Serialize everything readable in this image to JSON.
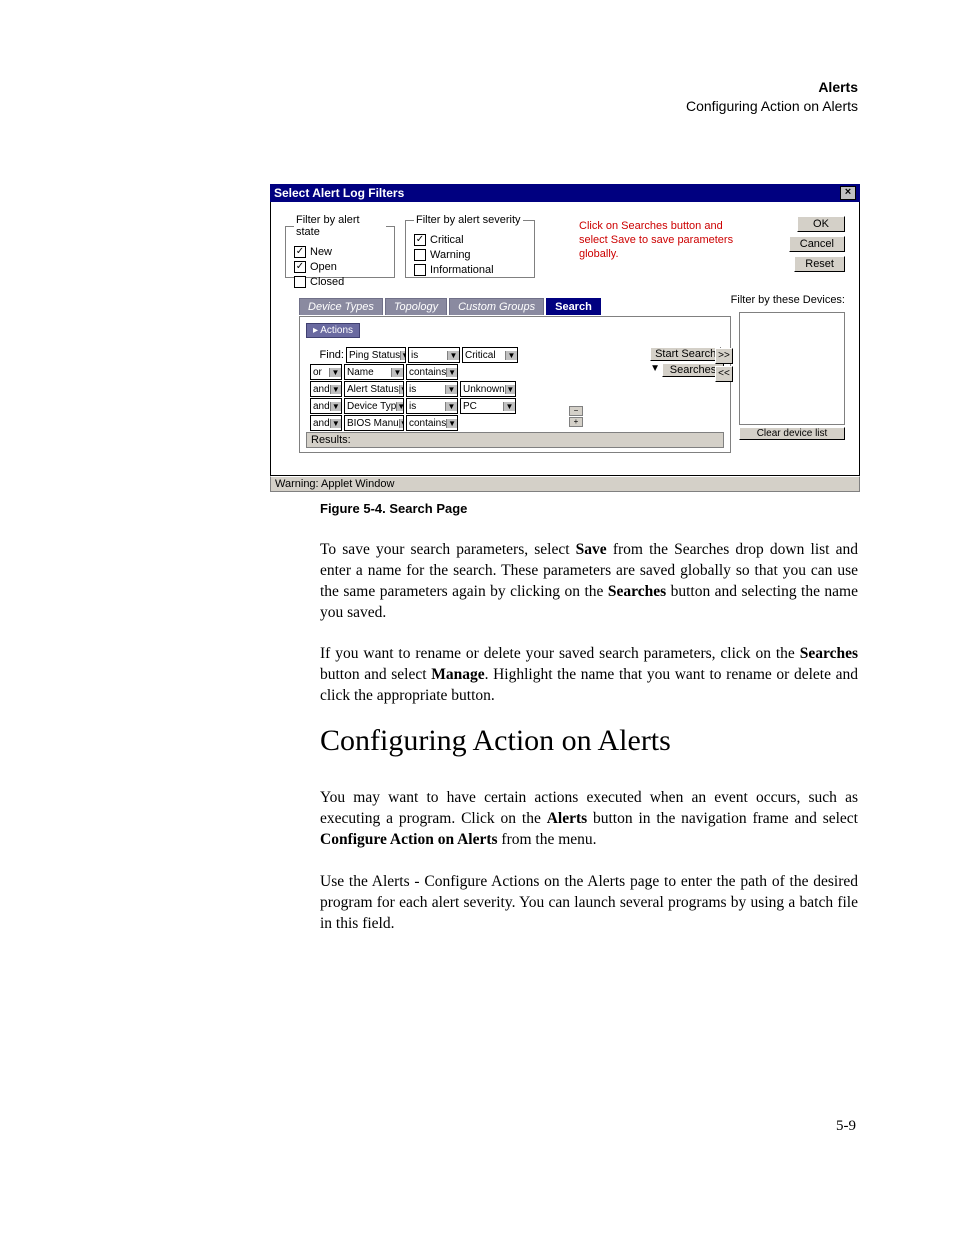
{
  "header": {
    "title": "Alerts",
    "subtitle": "Configuring Action on Alerts"
  },
  "dialog": {
    "title": "Select Alert Log Filters",
    "close_glyph": "×",
    "hint": "Click on Searches button and select Save to save parameters globally.",
    "buttons": {
      "ok": "OK",
      "cancel": "Cancel",
      "reset": "Reset"
    },
    "filter_by_devices_label": "Filter by these Devices:",
    "state_group": {
      "legend": "Filter by alert state",
      "items": [
        {
          "label": "New",
          "checked": true
        },
        {
          "label": "Open",
          "checked": true
        },
        {
          "label": "Closed",
          "checked": false
        }
      ]
    },
    "sev_group": {
      "legend": "Filter by alert severity",
      "items": [
        {
          "label": "Critical",
          "checked": true
        },
        {
          "label": "Warning",
          "checked": false
        },
        {
          "label": "Informational",
          "checked": false
        }
      ]
    },
    "tabs": {
      "t0": "Device Types",
      "t1": "Topology",
      "t2": "Custom Groups",
      "t3": "Search"
    },
    "actions_pill": "▸ Actions",
    "find_label": "Find:",
    "rows": [
      {
        "conn": "",
        "field": "Ping Status",
        "op": "is",
        "val": "Critical"
      },
      {
        "conn": "or",
        "field": "Name",
        "op": "contains",
        "val": ""
      },
      {
        "conn": "and",
        "field": "Alert Status",
        "op": "is",
        "val": "Unknown"
      },
      {
        "conn": "and",
        "field": "Device Typ",
        "op": "is",
        "val": "PC"
      },
      {
        "conn": "and",
        "field": "BIOS Manu",
        "op": "contains",
        "val": ""
      }
    ],
    "start_search": "Start Search",
    "searches_btn": "Searches",
    "tri_down": "▼",
    "move_right": ">>",
    "move_left": "<<",
    "stack_minus": "−",
    "stack_plus": "+",
    "results_label": "Results:",
    "clear_devices": "Clear device list",
    "applet_warn": "Warning: Applet Window"
  },
  "figure_caption": "Figure 5-4.    Search Page",
  "p1_a": "To save your search parameters, select ",
  "p1_b": "Save",
  "p1_c": " from the Searches drop down list and enter a name for the search. These parameters are saved globally so that you can use the same parameters again by clicking on the ",
  "p1_d": "Searches",
  "p1_e": " button and selecting the name you saved.",
  "p2_a": "If you want to rename or delete your saved search parameters, click on the ",
  "p2_b": "Searches",
  "p2_c": " button and select ",
  "p2_d": "Manage",
  "p2_e": ". Highlight the name that you want to rename or delete and click the appropriate button.",
  "section_heading": "Configuring Action on Alerts",
  "p3_a": "You may want to have certain actions executed when an event occurs, such as executing a program. Click on the ",
  "p3_b": "Alerts",
  "p3_c": " button in the navigation frame and select ",
  "p3_d": "Configure Action on Alerts",
  "p3_e": " from the menu.",
  "p4": "Use the Alerts - Configure Actions on the Alerts page to enter the path of the desired program for each alert severity. You can launch several programs by using a batch file in this field.",
  "page_number": "5-9"
}
